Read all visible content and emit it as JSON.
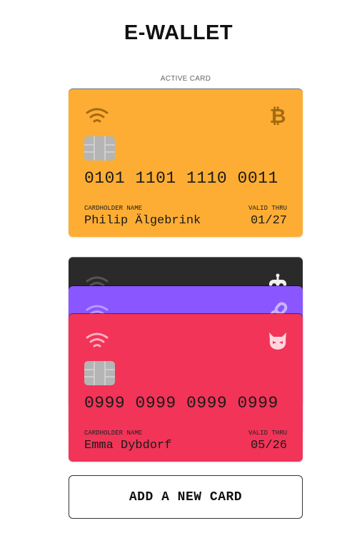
{
  "page": {
    "title": "E-WALLET"
  },
  "active_card": {
    "label": "ACTIVE CARD",
    "number": "0101 1101 1110 0011",
    "holder_label": "CARDHOLDER NAME",
    "holder": "Philip Älgebrink",
    "valid_label": "VALID THRU",
    "expiry": "01/27",
    "color": "#fdad33",
    "logo": "bitcoin-icon"
  },
  "stack": {
    "black_card": {
      "color": "#2a2a2a",
      "logo": "robot-icon"
    },
    "purple_card": {
      "color": "#8a56ff",
      "logo": "chain-link-icon"
    },
    "red_card": {
      "number": "0999 0999 0999 0999",
      "holder_label": "CARDHOLDER NAME",
      "holder": "Emma Dybdorf",
      "valid_label": "VALID THRU",
      "expiry": "05/26",
      "color": "#f13458",
      "logo": "devil-face-icon"
    }
  },
  "actions": {
    "add_card_label": "ADD A NEW CARD"
  }
}
